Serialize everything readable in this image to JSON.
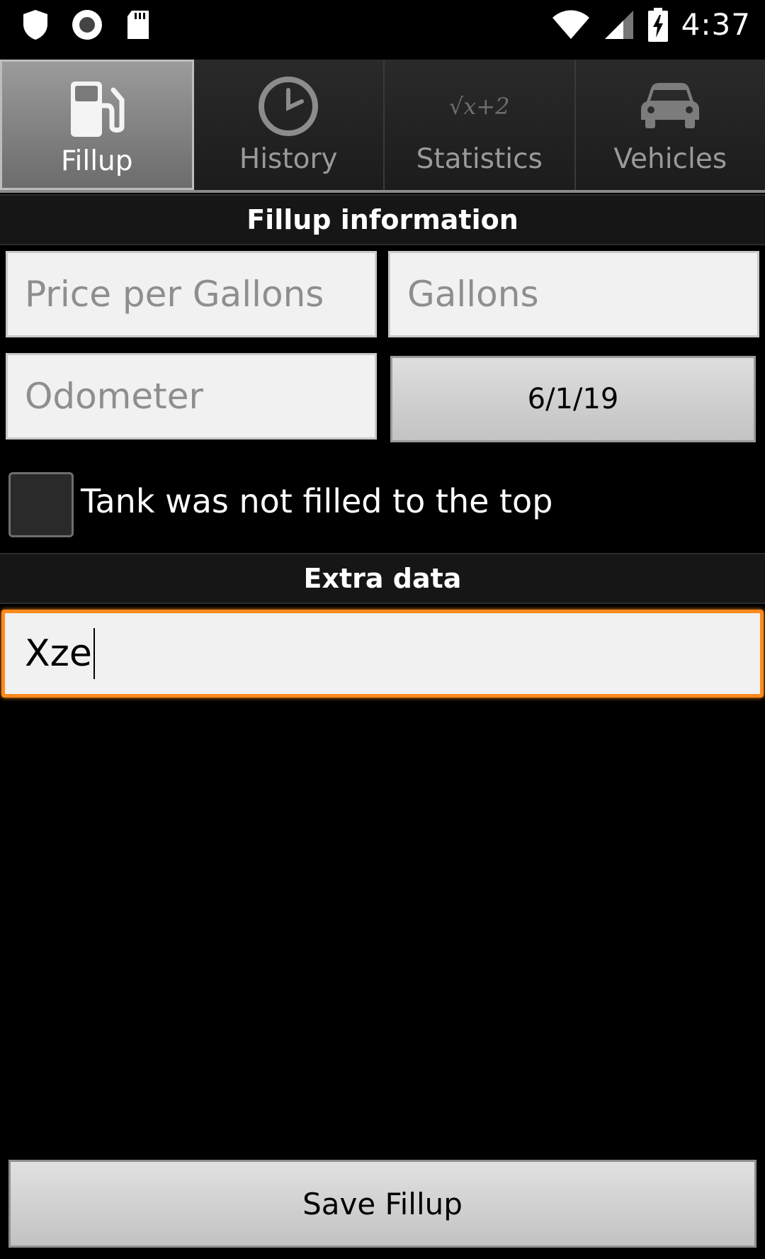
{
  "status_bar": {
    "time": "4:37",
    "icons": [
      "shield-icon",
      "record-icon",
      "sd-card-icon",
      "wifi-icon",
      "signal-icon",
      "battery-charging-icon"
    ]
  },
  "tabs": [
    {
      "label": "Fillup",
      "icon": "fuel-pump-icon",
      "active": true
    },
    {
      "label": "History",
      "icon": "clock-icon",
      "active": false
    },
    {
      "label": "Statistics",
      "icon": "sqrt-formula-icon",
      "active": false
    },
    {
      "label": "Vehicles",
      "icon": "car-icon",
      "active": false
    }
  ],
  "statistics_icon_text": "√x+2",
  "fillup_section": {
    "title": "Fillup information",
    "price_placeholder": "Price per Gallons",
    "gallons_placeholder": "Gallons",
    "odometer_placeholder": "Odometer",
    "date_value": "6/1/19",
    "checkbox_label": "Tank was not filled to the top",
    "checkbox_checked": false
  },
  "extra_section": {
    "title": "Extra data",
    "value": "Xze"
  },
  "save_button_label": "Save Fillup",
  "colors": {
    "focus_accent": "#ff8a1e",
    "background": "#000000",
    "field_bg": "#f1f1f1"
  }
}
